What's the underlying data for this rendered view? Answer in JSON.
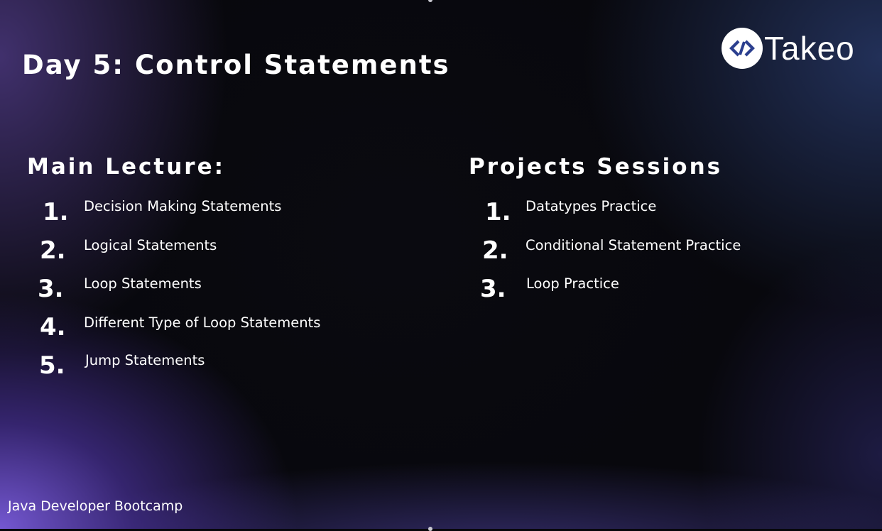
{
  "slide": {
    "title": "Day 5: Control Statements",
    "brand": {
      "name": "Takeo",
      "icon": "code-brackets-icon",
      "accent": "#2b3f8f"
    },
    "main_lecture": {
      "heading": "Main Lecture:",
      "items": [
        {
          "number": "1.",
          "label": "Decision Making Statements"
        },
        {
          "number": "2.",
          "label": "Logical Statements"
        },
        {
          "number": "3.",
          "label": "Loop Statements"
        },
        {
          "number": "4.",
          "label": "Different Type of Loop Statements"
        },
        {
          "number": "5.",
          "label": "Jump Statements"
        }
      ]
    },
    "projects": {
      "heading": "Projects Sessions",
      "items": [
        {
          "number": "1.",
          "label": "Datatypes Practice"
        },
        {
          "number": "2.",
          "label": "Conditional Statement Practice"
        },
        {
          "number": "3.",
          "label": "Loop Practice"
        }
      ]
    },
    "footer": "Java Developer Bootcamp"
  }
}
